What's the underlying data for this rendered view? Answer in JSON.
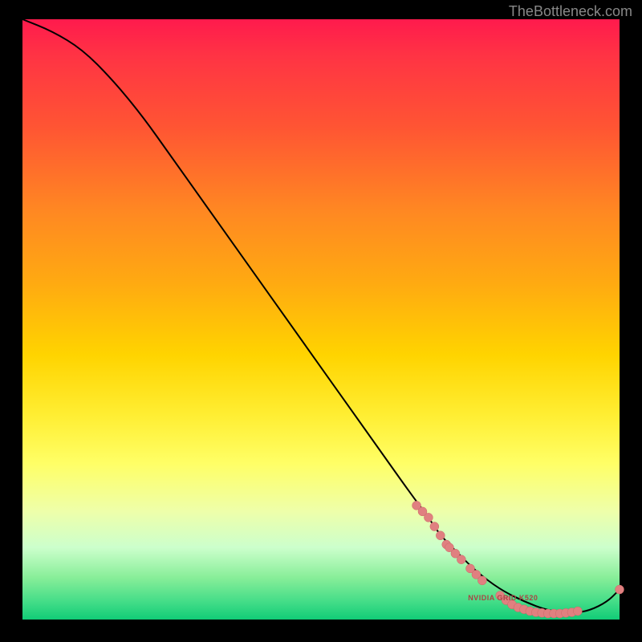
{
  "watermark": "TheBottleneck.com",
  "annotation": "NVIDIA GRID K520",
  "colors": {
    "curve": "#000000",
    "marker_fill": "#e08080",
    "marker_stroke": "#cc6666"
  },
  "chart_data": {
    "type": "line",
    "title": "",
    "xlabel": "",
    "ylabel": "",
    "xlim": [
      0,
      100
    ],
    "ylim": [
      0,
      100
    ],
    "curve": {
      "x": [
        0,
        5,
        10,
        15,
        20,
        25,
        30,
        35,
        40,
        45,
        50,
        55,
        60,
        65,
        68,
        70,
        73,
        76,
        80,
        84,
        88,
        92,
        95,
        98,
        100
      ],
      "y": [
        100,
        98,
        95,
        90,
        84,
        77,
        70,
        63,
        56,
        49,
        42,
        35,
        28,
        21,
        17,
        14,
        11,
        8,
        5,
        3,
        1.5,
        1,
        1.5,
        3,
        5
      ]
    },
    "markers": [
      {
        "x": 66,
        "y": 19
      },
      {
        "x": 67,
        "y": 18
      },
      {
        "x": 68,
        "y": 17
      },
      {
        "x": 69,
        "y": 15.5
      },
      {
        "x": 70,
        "y": 14
      },
      {
        "x": 71,
        "y": 12.5
      },
      {
        "x": 71.5,
        "y": 12
      },
      {
        "x": 72.5,
        "y": 11
      },
      {
        "x": 73.5,
        "y": 10
      },
      {
        "x": 75,
        "y": 8.5
      },
      {
        "x": 76,
        "y": 7.5
      },
      {
        "x": 77,
        "y": 6.5
      },
      {
        "x": 80,
        "y": 4
      },
      {
        "x": 81,
        "y": 3.2
      },
      {
        "x": 82,
        "y": 2.5
      },
      {
        "x": 83,
        "y": 2
      },
      {
        "x": 84,
        "y": 1.7
      },
      {
        "x": 85,
        "y": 1.4
      },
      {
        "x": 86,
        "y": 1.2
      },
      {
        "x": 87,
        "y": 1.1
      },
      {
        "x": 88,
        "y": 1
      },
      {
        "x": 89,
        "y": 1
      },
      {
        "x": 90,
        "y": 1
      },
      {
        "x": 91,
        "y": 1.1
      },
      {
        "x": 92,
        "y": 1.2
      },
      {
        "x": 93,
        "y": 1.4
      },
      {
        "x": 100,
        "y": 5
      }
    ],
    "annotation_pos": {
      "x": 80,
      "y": 3.5
    }
  }
}
